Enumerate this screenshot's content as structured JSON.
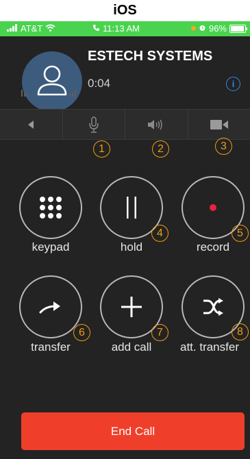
{
  "heading": "iOS",
  "status_bar": {
    "carrier": "AT&T",
    "time": "11:13 AM",
    "battery": "96%"
  },
  "call": {
    "caller_name": "ESTECH SYSTEMS",
    "duration": "0:04",
    "info_symbol": "i"
  },
  "toolbar": {
    "items": [
      {
        "icon": "speaker-left-icon"
      },
      {
        "icon": "microphone-icon"
      },
      {
        "icon": "volume-icon"
      },
      {
        "icon": "video-camera-icon"
      }
    ]
  },
  "annotations": [
    "1",
    "2",
    "3",
    "4",
    "5",
    "6",
    "7",
    "8"
  ],
  "controls": {
    "keypad": "keypad",
    "hold": "hold",
    "record": "record",
    "transfer": "transfer",
    "add_call": "add call",
    "att_transfer": "att. transfer"
  },
  "end_call": "End Call",
  "colors": {
    "status_bar": "#4ad34f",
    "background": "#232323",
    "end_call": "#ef3f2a",
    "annotation": "#f39c12",
    "info": "#2f8be6",
    "record_dot": "#e8243b"
  }
}
